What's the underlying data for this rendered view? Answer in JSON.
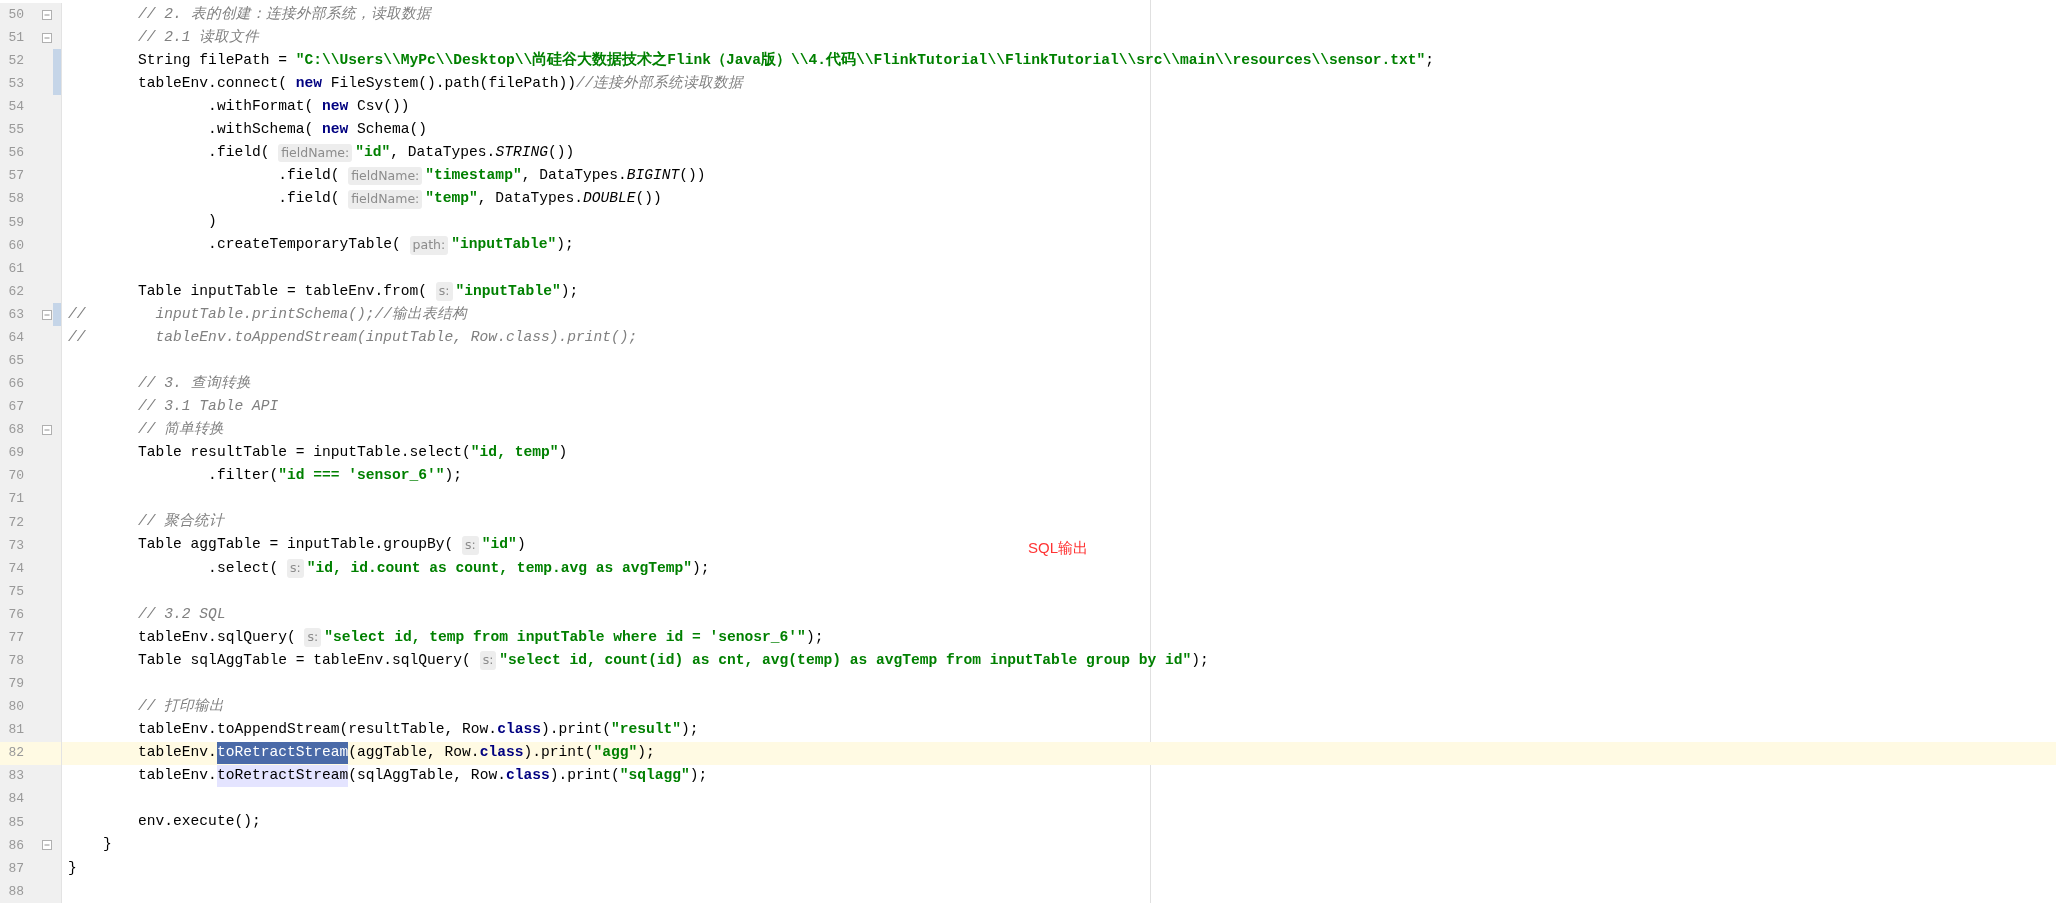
{
  "editor": {
    "lines": [
      {
        "n": "50",
        "current": false,
        "changed": false,
        "fold": true,
        "tokens": [
          {
            "kind": "comment",
            "text": "        // 2. 表的创建：连接外部系统，读取数据"
          }
        ]
      },
      {
        "n": "51",
        "current": false,
        "changed": false,
        "fold": true,
        "tokens": [
          {
            "kind": "comment",
            "text": "        // 2.1 读取文件"
          }
        ]
      },
      {
        "n": "52",
        "current": false,
        "changed": true,
        "fold": false,
        "tokens": [
          {
            "kind": "plain",
            "text": "        String filePath = "
          },
          {
            "kind": "string",
            "text": "\"C:\\\\Users\\\\MyPc\\\\Desktop\\\\尚硅谷大数据技术之Flink（Java版）\\\\4.代码\\\\FlinkTutorial\\\\FlinkTutorial\\\\src\\\\main\\\\resources\\\\sensor.txt\""
          },
          {
            "kind": "plain",
            "text": ";"
          }
        ]
      },
      {
        "n": "53",
        "current": false,
        "changed": true,
        "fold": false,
        "tokens": [
          {
            "kind": "plain",
            "text": "        tableEnv.connect( "
          },
          {
            "kind": "keyword",
            "text": "new"
          },
          {
            "kind": "plain",
            "text": " FileSystem().path(filePath))"
          },
          {
            "kind": "comment",
            "text": "//连接外部系统读取数据"
          }
        ]
      },
      {
        "n": "54",
        "current": false,
        "changed": false,
        "fold": false,
        "tokens": [
          {
            "kind": "plain",
            "text": "                .withFormat( "
          },
          {
            "kind": "keyword",
            "text": "new"
          },
          {
            "kind": "plain",
            "text": " Csv())"
          }
        ]
      },
      {
        "n": "55",
        "current": false,
        "changed": false,
        "fold": false,
        "tokens": [
          {
            "kind": "plain",
            "text": "                .withSchema( "
          },
          {
            "kind": "keyword",
            "text": "new"
          },
          {
            "kind": "plain",
            "text": " Schema()"
          }
        ]
      },
      {
        "n": "56",
        "current": false,
        "changed": false,
        "fold": false,
        "tokens": [
          {
            "kind": "plain",
            "text": "                .field( "
          },
          {
            "kind": "hint",
            "text": "fieldName:"
          },
          {
            "kind": "string",
            "text": "\"id\""
          },
          {
            "kind": "plain",
            "text": ", DataTypes."
          },
          {
            "kind": "static",
            "text": "STRING"
          },
          {
            "kind": "plain",
            "text": "())"
          }
        ]
      },
      {
        "n": "57",
        "current": false,
        "changed": false,
        "fold": false,
        "tokens": [
          {
            "kind": "plain",
            "text": "                        .field( "
          },
          {
            "kind": "hint",
            "text": "fieldName:"
          },
          {
            "kind": "string",
            "text": "\"timestamp\""
          },
          {
            "kind": "plain",
            "text": ", DataTypes."
          },
          {
            "kind": "static",
            "text": "BIGINT"
          },
          {
            "kind": "plain",
            "text": "())"
          }
        ]
      },
      {
        "n": "58",
        "current": false,
        "changed": false,
        "fold": false,
        "tokens": [
          {
            "kind": "plain",
            "text": "                        .field( "
          },
          {
            "kind": "hint",
            "text": "fieldName:"
          },
          {
            "kind": "string",
            "text": "\"temp\""
          },
          {
            "kind": "plain",
            "text": ", DataTypes."
          },
          {
            "kind": "static",
            "text": "DOUBLE"
          },
          {
            "kind": "plain",
            "text": "())"
          }
        ]
      },
      {
        "n": "59",
        "current": false,
        "changed": false,
        "fold": false,
        "tokens": [
          {
            "kind": "plain",
            "text": "                )"
          }
        ]
      },
      {
        "n": "60",
        "current": false,
        "changed": false,
        "fold": false,
        "tokens": [
          {
            "kind": "plain",
            "text": "                .createTemporaryTable( "
          },
          {
            "kind": "hint",
            "text": "path:"
          },
          {
            "kind": "string",
            "text": "\"inputTable\""
          },
          {
            "kind": "plain",
            "text": ");"
          }
        ]
      },
      {
        "n": "61",
        "current": false,
        "changed": false,
        "fold": false
      },
      {
        "n": "62",
        "current": false,
        "changed": false,
        "fold": false,
        "tokens": [
          {
            "kind": "plain",
            "text": "        Table inputTable = tableEnv.from( "
          },
          {
            "kind": "hint",
            "text": "s:"
          },
          {
            "kind": "string",
            "text": "\"inputTable\""
          },
          {
            "kind": "plain",
            "text": ");"
          }
        ]
      },
      {
        "n": "63",
        "current": false,
        "changed": true,
        "fold": true,
        "tokens": [
          {
            "kind": "comment",
            "text": "//        inputTable.printSchema();//输出表结构"
          }
        ]
      },
      {
        "n": "64",
        "current": false,
        "changed": false,
        "fold": false,
        "tokens": [
          {
            "kind": "comment",
            "text": "//        tableEnv.toAppendStream(inputTable, Row.class).print();"
          }
        ]
      },
      {
        "n": "65",
        "current": false,
        "changed": false,
        "fold": false
      },
      {
        "n": "66",
        "current": false,
        "changed": false,
        "fold": false,
        "tokens": [
          {
            "kind": "comment",
            "text": "        // 3. 查询转换"
          }
        ]
      },
      {
        "n": "67",
        "current": false,
        "changed": false,
        "fold": false,
        "tokens": [
          {
            "kind": "comment",
            "text": "        // 3.1 Table API"
          }
        ]
      },
      {
        "n": "68",
        "current": false,
        "changed": false,
        "fold": true,
        "tokens": [
          {
            "kind": "comment",
            "text": "        // 简单转换"
          }
        ]
      },
      {
        "n": "69",
        "current": false,
        "changed": false,
        "fold": false,
        "tokens": [
          {
            "kind": "plain",
            "text": "        Table resultTable = inputTable.select("
          },
          {
            "kind": "string",
            "text": "\"id, temp\""
          },
          {
            "kind": "plain",
            "text": ")"
          }
        ]
      },
      {
        "n": "70",
        "current": false,
        "changed": false,
        "fold": false,
        "tokens": [
          {
            "kind": "plain",
            "text": "                .filter("
          },
          {
            "kind": "string",
            "text": "\"id === 'sensor_6'\""
          },
          {
            "kind": "plain",
            "text": ");"
          }
        ]
      },
      {
        "n": "71",
        "current": false,
        "changed": false,
        "fold": false
      },
      {
        "n": "72",
        "current": false,
        "changed": false,
        "fold": false,
        "tokens": [
          {
            "kind": "comment",
            "text": "        // 聚合统计"
          }
        ]
      },
      {
        "n": "73",
        "current": false,
        "changed": false,
        "fold": false,
        "tokens": [
          {
            "kind": "plain",
            "text": "        Table aggTable = inputTable.groupBy( "
          },
          {
            "kind": "hint",
            "text": "s:"
          },
          {
            "kind": "string",
            "text": "\"id\""
          },
          {
            "kind": "plain",
            "text": ")"
          }
        ]
      },
      {
        "n": "74",
        "current": false,
        "changed": false,
        "fold": false,
        "tokens": [
          {
            "kind": "plain",
            "text": "                .select( "
          },
          {
            "kind": "hint",
            "text": "s:"
          },
          {
            "kind": "string",
            "text": "\"id, id.count as count, temp.avg as avgTemp\""
          },
          {
            "kind": "plain",
            "text": ");"
          }
        ]
      },
      {
        "n": "75",
        "current": false,
        "changed": false,
        "fold": false
      },
      {
        "n": "76",
        "current": false,
        "changed": false,
        "fold": false,
        "tokens": [
          {
            "kind": "comment",
            "text": "        // 3.2 SQL"
          }
        ]
      },
      {
        "n": "77",
        "current": false,
        "changed": false,
        "fold": false,
        "tokens": [
          {
            "kind": "plain",
            "text": "        tableEnv.sqlQuery( "
          },
          {
            "kind": "hint",
            "text": "s:"
          },
          {
            "kind": "string",
            "text": "\"select id, temp from inputTable where id = 'senosr_6'\""
          },
          {
            "kind": "plain",
            "text": ");"
          }
        ]
      },
      {
        "n": "78",
        "current": false,
        "changed": false,
        "fold": false,
        "tokens": [
          {
            "kind": "plain",
            "text": "        Table sqlAggTable = tableEnv.sqlQuery( "
          },
          {
            "kind": "hint",
            "text": "s:"
          },
          {
            "kind": "string",
            "text": "\"select id, count(id) as cnt, avg(temp) as avgTemp from inputTable group by id\""
          },
          {
            "kind": "plain",
            "text": ");"
          }
        ]
      },
      {
        "n": "79",
        "current": false,
        "changed": false,
        "fold": false
      },
      {
        "n": "80",
        "current": false,
        "changed": false,
        "fold": false,
        "tokens": [
          {
            "kind": "comment",
            "text": "        // 打印输出"
          }
        ]
      },
      {
        "n": "81",
        "current": false,
        "changed": false,
        "fold": false,
        "tokens": [
          {
            "kind": "plain",
            "text": "        tableEnv.toAppendStream(resultTable, Row."
          },
          {
            "kind": "keyword",
            "text": "class"
          },
          {
            "kind": "plain",
            "text": ").print("
          },
          {
            "kind": "string",
            "text": "\"result\""
          },
          {
            "kind": "plain",
            "text": ");"
          }
        ]
      },
      {
        "n": "82",
        "current": true,
        "changed": false,
        "fold": false,
        "tokens": [
          {
            "kind": "plain",
            "text": "        tableEnv."
          },
          {
            "kind": "selected",
            "text": "toRetractStream"
          },
          {
            "kind": "plain",
            "text": "(aggTable, Row."
          },
          {
            "kind": "keyword",
            "text": "class"
          },
          {
            "kind": "plain",
            "text": ").print("
          },
          {
            "kind": "string",
            "text": "\"agg\""
          },
          {
            "kind": "plain",
            "text": ");"
          }
        ]
      },
      {
        "n": "83",
        "current": false,
        "changed": false,
        "fold": false,
        "tokens": [
          {
            "kind": "plain",
            "text": "        tableEnv."
          },
          {
            "kind": "usage",
            "text": "toRetractStream"
          },
          {
            "kind": "plain",
            "text": "(sqlAggTable, Row."
          },
          {
            "kind": "keyword",
            "text": "class"
          },
          {
            "kind": "plain",
            "text": ").print("
          },
          {
            "kind": "string",
            "text": "\"sqlagg\""
          },
          {
            "kind": "plain",
            "text": ");"
          }
        ]
      },
      {
        "n": "84",
        "current": false,
        "changed": false,
        "fold": false
      },
      {
        "n": "85",
        "current": false,
        "changed": false,
        "fold": false,
        "tokens": [
          {
            "kind": "plain",
            "text": "        env.execute();"
          }
        ]
      },
      {
        "n": "86",
        "current": false,
        "changed": false,
        "fold": true,
        "tokens": [
          {
            "kind": "plain",
            "text": "    }"
          }
        ]
      },
      {
        "n": "87",
        "current": false,
        "changed": false,
        "fold": false,
        "tokens": [
          {
            "kind": "plain",
            "text": "}"
          }
        ]
      },
      {
        "n": "88",
        "current": false,
        "changed": false,
        "fold": false
      }
    ]
  },
  "annotation": "SQL输出"
}
